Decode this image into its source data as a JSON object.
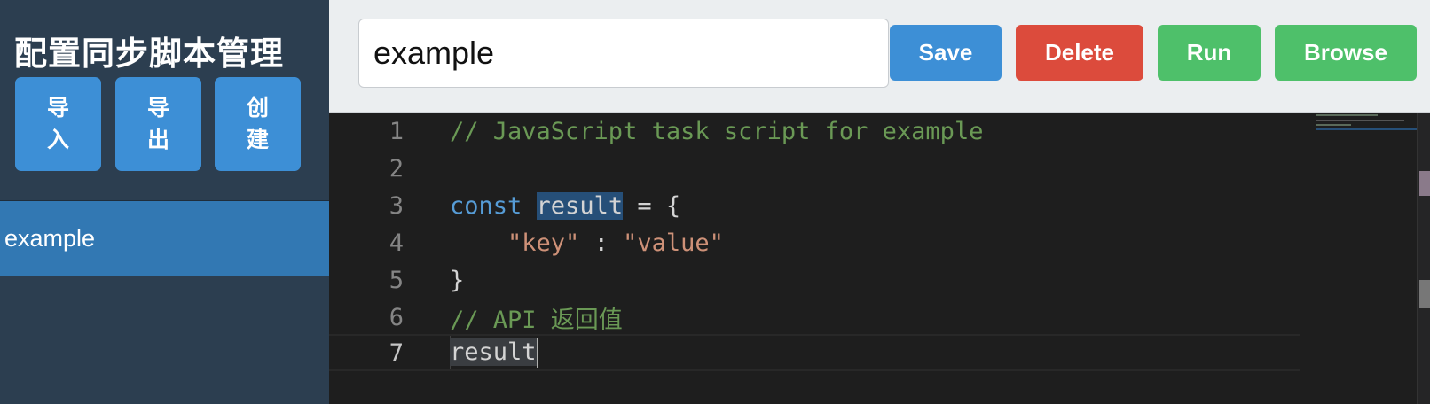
{
  "sidebar": {
    "title": "配置同步脚本管理",
    "buttons": {
      "import": "导入",
      "export": "导出",
      "create": "创建"
    },
    "scripts": [
      "example"
    ]
  },
  "header": {
    "script_name": "example",
    "save_label": "Save",
    "delete_label": "Delete",
    "run_label": "Run",
    "browse_label": "Browse"
  },
  "editor": {
    "language": "javascript",
    "lines": [
      {
        "num": "1",
        "text": "// JavaScript task script for example"
      },
      {
        "num": "2",
        "text": ""
      },
      {
        "num": "3",
        "kw": "const",
        "ident": "result",
        "rest": " = {"
      },
      {
        "num": "4",
        "key": "\"key\"",
        "sep": " : ",
        "value": "\"value\""
      },
      {
        "num": "5",
        "text": "}"
      },
      {
        "num": "6",
        "text": "// API 返回值"
      },
      {
        "num": "7",
        "text": "result"
      }
    ],
    "active_line": 7
  },
  "colors": {
    "sidebar_bg": "#2c3e50",
    "primary": "#3d8fd6",
    "danger": "#dc4b3c",
    "success": "#4ec06a",
    "selected_item": "#3278b3"
  }
}
